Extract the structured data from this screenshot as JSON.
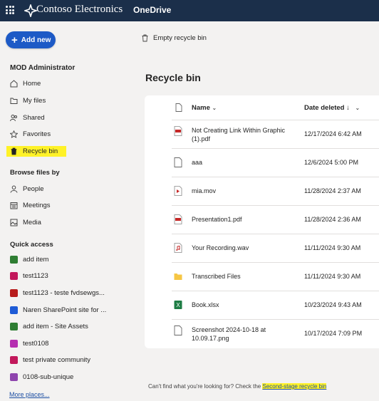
{
  "header": {
    "brand": "Contoso Electronics",
    "app": "OneDrive"
  },
  "sidebar": {
    "add_new": "Add new",
    "user": "MOD Administrator",
    "nav": [
      {
        "label": "Home",
        "icon": "home-icon"
      },
      {
        "label": "My files",
        "icon": "folder-icon"
      },
      {
        "label": "Shared",
        "icon": "people-icon"
      },
      {
        "label": "Favorites",
        "icon": "star-icon"
      },
      {
        "label": "Recycle bin",
        "icon": "trash-icon"
      }
    ],
    "browse_title": "Browse files by",
    "browse": [
      {
        "label": "People",
        "icon": "person-icon"
      },
      {
        "label": "Meetings",
        "icon": "calendar-icon"
      },
      {
        "label": "Media",
        "icon": "image-icon"
      }
    ],
    "quick_title": "Quick access",
    "quick": [
      {
        "label": "add item",
        "color": "#2e7d32"
      },
      {
        "label": "test1123",
        "color": "#c2185b"
      },
      {
        "label": "test1123 - teste fvdsewgs...",
        "color": "#b71c1c"
      },
      {
        "label": "Naren SharePoint site for ...",
        "color": "#1e5bd6"
      },
      {
        "label": "add item - Site Assets",
        "color": "#2e7d32"
      },
      {
        "label": "test0108",
        "color": "#b52fb0"
      },
      {
        "label": "test private community",
        "color": "#c2185b"
      },
      {
        "label": "0108-sub-unique",
        "color": "#8e44ad"
      }
    ],
    "more": "More places..."
  },
  "toolbar": {
    "empty": "Empty recycle bin"
  },
  "main": {
    "title": "Recycle bin",
    "col_name": "Name",
    "col_date": "Date deleted ↓"
  },
  "files": [
    {
      "name": "Not Creating Link Within Graphic (1).pdf",
      "date": "12/17/2024 6:42 AM",
      "icon": "pdf-icon"
    },
    {
      "name": "aaa",
      "date": "12/6/2024 5:00 PM",
      "icon": "file-icon"
    },
    {
      "name": "mia.mov",
      "date": "11/28/2024 2:37 AM",
      "icon": "video-icon"
    },
    {
      "name": "Presentation1.pdf",
      "date": "11/28/2024 2:36 AM",
      "icon": "pdf-icon"
    },
    {
      "name": "Your Recording.wav",
      "date": "11/11/2024 9:30 AM",
      "icon": "audio-icon"
    },
    {
      "name": "Transcribed Files",
      "date": "11/11/2024 9:30 AM",
      "icon": "folder-icon"
    },
    {
      "name": "Book.xlsx",
      "date": "10/23/2024 9:43 AM",
      "icon": "excel-icon"
    },
    {
      "name": "Screenshot 2024-10-18 at 10.09.17.png",
      "date": "10/17/2024 7:09 PM",
      "icon": "image-file-icon"
    }
  ],
  "footer": {
    "text": "Can't find what you're looking for? Check the ",
    "link": "Second-stage recycle bin"
  }
}
